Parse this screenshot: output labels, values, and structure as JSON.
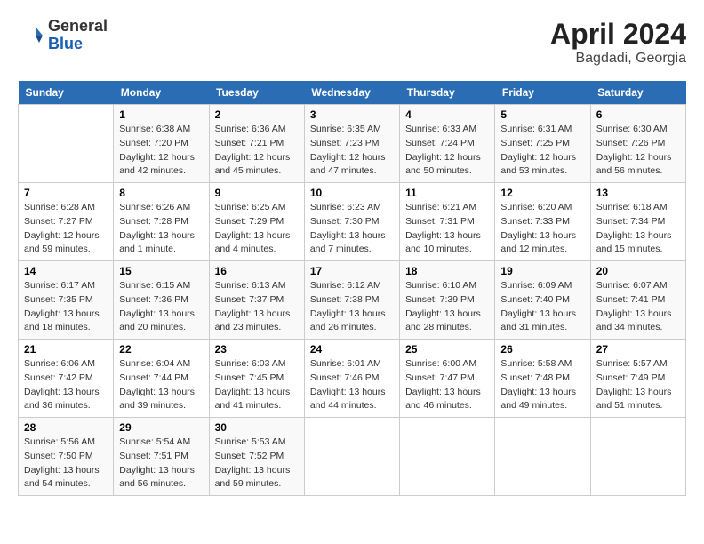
{
  "header": {
    "logo_general": "General",
    "logo_blue": "Blue",
    "title": "April 2024",
    "subtitle": "Bagdadi, Georgia"
  },
  "calendar": {
    "days_of_week": [
      "Sunday",
      "Monday",
      "Tuesday",
      "Wednesday",
      "Thursday",
      "Friday",
      "Saturday"
    ],
    "weeks": [
      [
        {
          "day": "",
          "info": ""
        },
        {
          "day": "1",
          "info": "Sunrise: 6:38 AM\nSunset: 7:20 PM\nDaylight: 12 hours\nand 42 minutes."
        },
        {
          "day": "2",
          "info": "Sunrise: 6:36 AM\nSunset: 7:21 PM\nDaylight: 12 hours\nand 45 minutes."
        },
        {
          "day": "3",
          "info": "Sunrise: 6:35 AM\nSunset: 7:23 PM\nDaylight: 12 hours\nand 47 minutes."
        },
        {
          "day": "4",
          "info": "Sunrise: 6:33 AM\nSunset: 7:24 PM\nDaylight: 12 hours\nand 50 minutes."
        },
        {
          "day": "5",
          "info": "Sunrise: 6:31 AM\nSunset: 7:25 PM\nDaylight: 12 hours\nand 53 minutes."
        },
        {
          "day": "6",
          "info": "Sunrise: 6:30 AM\nSunset: 7:26 PM\nDaylight: 12 hours\nand 56 minutes."
        }
      ],
      [
        {
          "day": "7",
          "info": "Sunrise: 6:28 AM\nSunset: 7:27 PM\nDaylight: 12 hours\nand 59 minutes."
        },
        {
          "day": "8",
          "info": "Sunrise: 6:26 AM\nSunset: 7:28 PM\nDaylight: 13 hours\nand 1 minute."
        },
        {
          "day": "9",
          "info": "Sunrise: 6:25 AM\nSunset: 7:29 PM\nDaylight: 13 hours\nand 4 minutes."
        },
        {
          "day": "10",
          "info": "Sunrise: 6:23 AM\nSunset: 7:30 PM\nDaylight: 13 hours\nand 7 minutes."
        },
        {
          "day": "11",
          "info": "Sunrise: 6:21 AM\nSunset: 7:31 PM\nDaylight: 13 hours\nand 10 minutes."
        },
        {
          "day": "12",
          "info": "Sunrise: 6:20 AM\nSunset: 7:33 PM\nDaylight: 13 hours\nand 12 minutes."
        },
        {
          "day": "13",
          "info": "Sunrise: 6:18 AM\nSunset: 7:34 PM\nDaylight: 13 hours\nand 15 minutes."
        }
      ],
      [
        {
          "day": "14",
          "info": "Sunrise: 6:17 AM\nSunset: 7:35 PM\nDaylight: 13 hours\nand 18 minutes."
        },
        {
          "day": "15",
          "info": "Sunrise: 6:15 AM\nSunset: 7:36 PM\nDaylight: 13 hours\nand 20 minutes."
        },
        {
          "day": "16",
          "info": "Sunrise: 6:13 AM\nSunset: 7:37 PM\nDaylight: 13 hours\nand 23 minutes."
        },
        {
          "day": "17",
          "info": "Sunrise: 6:12 AM\nSunset: 7:38 PM\nDaylight: 13 hours\nand 26 minutes."
        },
        {
          "day": "18",
          "info": "Sunrise: 6:10 AM\nSunset: 7:39 PM\nDaylight: 13 hours\nand 28 minutes."
        },
        {
          "day": "19",
          "info": "Sunrise: 6:09 AM\nSunset: 7:40 PM\nDaylight: 13 hours\nand 31 minutes."
        },
        {
          "day": "20",
          "info": "Sunrise: 6:07 AM\nSunset: 7:41 PM\nDaylight: 13 hours\nand 34 minutes."
        }
      ],
      [
        {
          "day": "21",
          "info": "Sunrise: 6:06 AM\nSunset: 7:42 PM\nDaylight: 13 hours\nand 36 minutes."
        },
        {
          "day": "22",
          "info": "Sunrise: 6:04 AM\nSunset: 7:44 PM\nDaylight: 13 hours\nand 39 minutes."
        },
        {
          "day": "23",
          "info": "Sunrise: 6:03 AM\nSunset: 7:45 PM\nDaylight: 13 hours\nand 41 minutes."
        },
        {
          "day": "24",
          "info": "Sunrise: 6:01 AM\nSunset: 7:46 PM\nDaylight: 13 hours\nand 44 minutes."
        },
        {
          "day": "25",
          "info": "Sunrise: 6:00 AM\nSunset: 7:47 PM\nDaylight: 13 hours\nand 46 minutes."
        },
        {
          "day": "26",
          "info": "Sunrise: 5:58 AM\nSunset: 7:48 PM\nDaylight: 13 hours\nand 49 minutes."
        },
        {
          "day": "27",
          "info": "Sunrise: 5:57 AM\nSunset: 7:49 PM\nDaylight: 13 hours\nand 51 minutes."
        }
      ],
      [
        {
          "day": "28",
          "info": "Sunrise: 5:56 AM\nSunset: 7:50 PM\nDaylight: 13 hours\nand 54 minutes."
        },
        {
          "day": "29",
          "info": "Sunrise: 5:54 AM\nSunset: 7:51 PM\nDaylight: 13 hours\nand 56 minutes."
        },
        {
          "day": "30",
          "info": "Sunrise: 5:53 AM\nSunset: 7:52 PM\nDaylight: 13 hours\nand 59 minutes."
        },
        {
          "day": "",
          "info": ""
        },
        {
          "day": "",
          "info": ""
        },
        {
          "day": "",
          "info": ""
        },
        {
          "day": "",
          "info": ""
        }
      ]
    ]
  }
}
